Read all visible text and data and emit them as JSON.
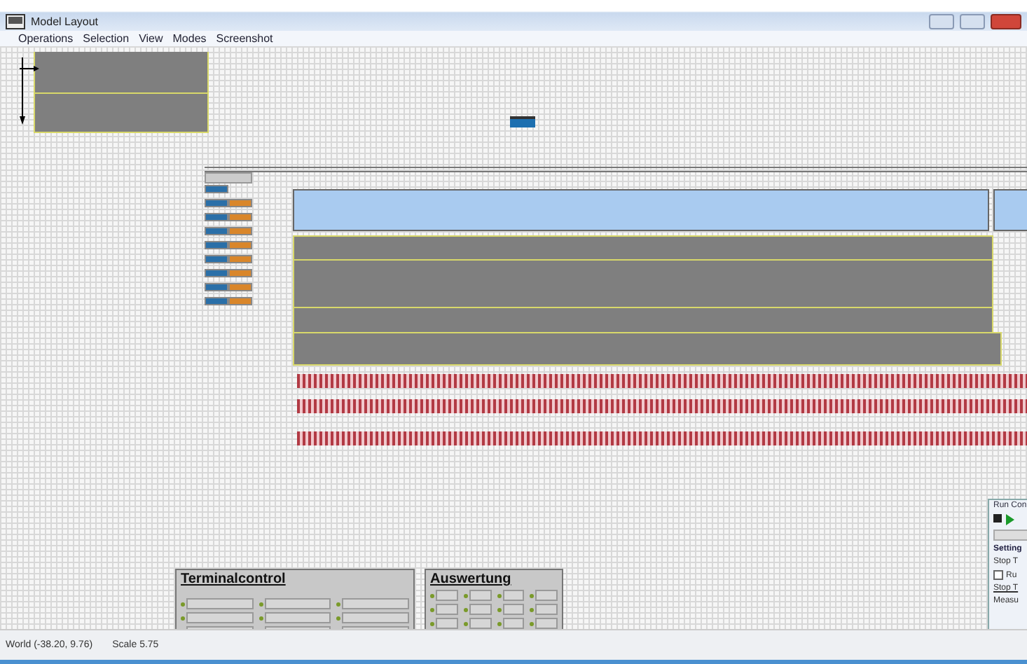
{
  "window": {
    "title": "Model Layout"
  },
  "menu": [
    "Operations",
    "Selection",
    "View",
    "Modes",
    "Screenshot"
  ],
  "panels": [
    {
      "title": "Terminalcontrol",
      "kind": "terminal"
    },
    {
      "title": "Auswertung",
      "kind": "eval"
    }
  ],
  "run_control": {
    "title": "Run Con",
    "tab": "Setting",
    "label_1": "Stop T",
    "checkbox": {
      "label": "Ru",
      "checked": false
    },
    "label_2": "Stop T",
    "label_3": "Measu"
  },
  "status_bar": {
    "world": "World (-38.20, 9.76)",
    "scale": "Scale 5.75"
  }
}
